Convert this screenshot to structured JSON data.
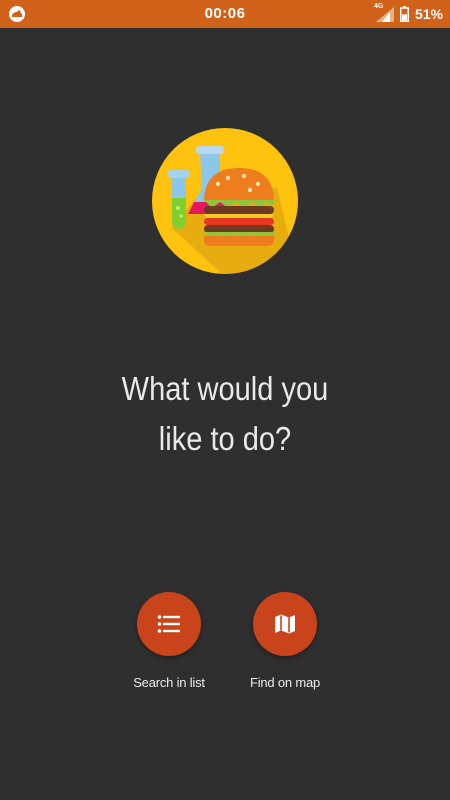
{
  "status_bar": {
    "time": "00:06",
    "network_type": "4G",
    "battery_percent": "51%",
    "battery_level": 0.51,
    "background_color": "#d0621a",
    "notification_icon": "app-notification-icon"
  },
  "hero": {
    "logo_icon": "burger-and-test-tubes-logo-icon",
    "logo_circle_color": "#fec20f"
  },
  "prompt": {
    "line1": "What would you",
    "line2": "like to do?"
  },
  "actions": {
    "search_list": {
      "label": "Search in list",
      "icon": "list-icon"
    },
    "find_map": {
      "label": "Find on map",
      "icon": "map-icon"
    },
    "button_color": "#c9431b"
  },
  "colors": {
    "background": "#2f2f2f",
    "text": "#e9e9e9"
  }
}
